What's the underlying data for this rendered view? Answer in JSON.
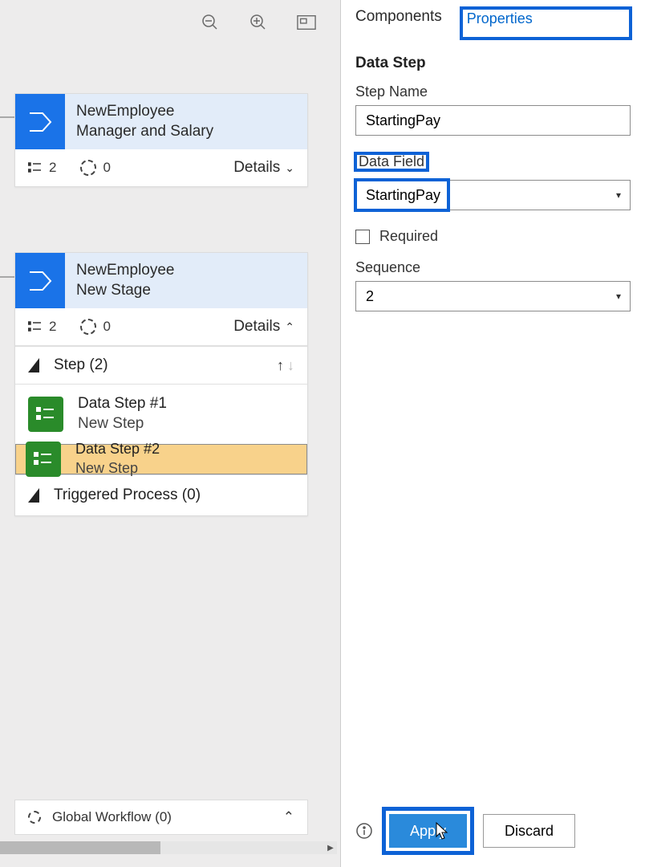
{
  "toolbar": {},
  "stages": [
    {
      "title1": "NewEmployee",
      "title2": "Manager and Salary",
      "count1": "2",
      "count2": "0",
      "details": "Details"
    },
    {
      "title1": "NewEmployee",
      "title2": "New Stage",
      "count1": "2",
      "count2": "0",
      "details": "Details",
      "step_header": "Step (2)",
      "steps": [
        {
          "label": "Data Step #1",
          "sub": "New Step"
        },
        {
          "label": "Data Step #2",
          "sub": "New Step"
        }
      ],
      "triggered": "Triggered Process (0)"
    }
  ],
  "global_workflow": "Global Workflow (0)",
  "tabs": {
    "components": "Components",
    "properties": "Properties"
  },
  "panel": {
    "section_title": "Data Step",
    "step_name_label": "Step Name",
    "step_name_value": "StartingPay",
    "data_field_label": "Data Field",
    "data_field_value": "StartingPay",
    "required_label": "Required",
    "sequence_label": "Sequence",
    "sequence_value": "2"
  },
  "footer": {
    "apply": "Apply",
    "discard": "Discard"
  }
}
